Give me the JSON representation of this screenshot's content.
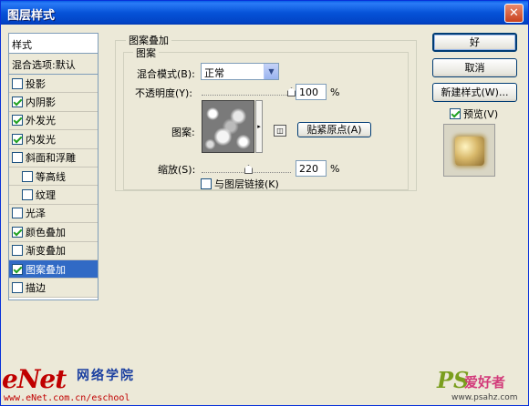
{
  "window": {
    "title": "图层样式",
    "close_glyph": "✕"
  },
  "styles_panel": {
    "header": "样式",
    "blend_options": "混合选项:默认",
    "items": [
      {
        "label": "投影",
        "checked": false,
        "indent": false,
        "selected": false
      },
      {
        "label": "内阴影",
        "checked": true,
        "indent": false,
        "selected": false
      },
      {
        "label": "外发光",
        "checked": true,
        "indent": false,
        "selected": false
      },
      {
        "label": "内发光",
        "checked": true,
        "indent": false,
        "selected": false
      },
      {
        "label": "斜面和浮雕",
        "checked": false,
        "indent": false,
        "selected": false
      },
      {
        "label": "等高线",
        "checked": false,
        "indent": true,
        "selected": false
      },
      {
        "label": "纹理",
        "checked": false,
        "indent": true,
        "selected": false
      },
      {
        "label": "光泽",
        "checked": false,
        "indent": false,
        "selected": false
      },
      {
        "label": "颜色叠加",
        "checked": true,
        "indent": false,
        "selected": false
      },
      {
        "label": "渐变叠加",
        "checked": false,
        "indent": false,
        "selected": false
      },
      {
        "label": "图案叠加",
        "checked": true,
        "indent": false,
        "selected": true
      },
      {
        "label": "描边",
        "checked": false,
        "indent": false,
        "selected": false
      }
    ]
  },
  "pattern_overlay": {
    "group_title": "图案叠加",
    "subgroup_title": "图案",
    "blend_mode_label": "混合模式(B):",
    "blend_mode_value": "正常",
    "opacity_label": "不透明度(Y):",
    "opacity_value": "100",
    "opacity_unit": "%",
    "opacity_slider": 1.0,
    "pattern_label": "图案:",
    "snap_origin_button": "贴紧原点(A)",
    "scale_label": "缩放(S):",
    "scale_value": "220",
    "scale_unit": "%",
    "scale_slider": 0.52,
    "link_layer_label": "与图层链接(K)",
    "link_layer_checked": false
  },
  "buttons": {
    "ok": "好",
    "cancel": "取消",
    "new_style": "新建样式(W)...",
    "preview_label": "预览(V)",
    "preview_checked": true
  },
  "watermarks": {
    "enet_logo": "eNet",
    "enet_cn": "网络学院",
    "enet_url": "www.eNet.com.cn/eschool",
    "ps_logo": "PS",
    "ps_cn": "爱好者",
    "ps_url": "www.psahz.com"
  },
  "colors": {
    "title_bar": "#0653d8",
    "selection": "#316ac5",
    "check": "#21a121"
  }
}
